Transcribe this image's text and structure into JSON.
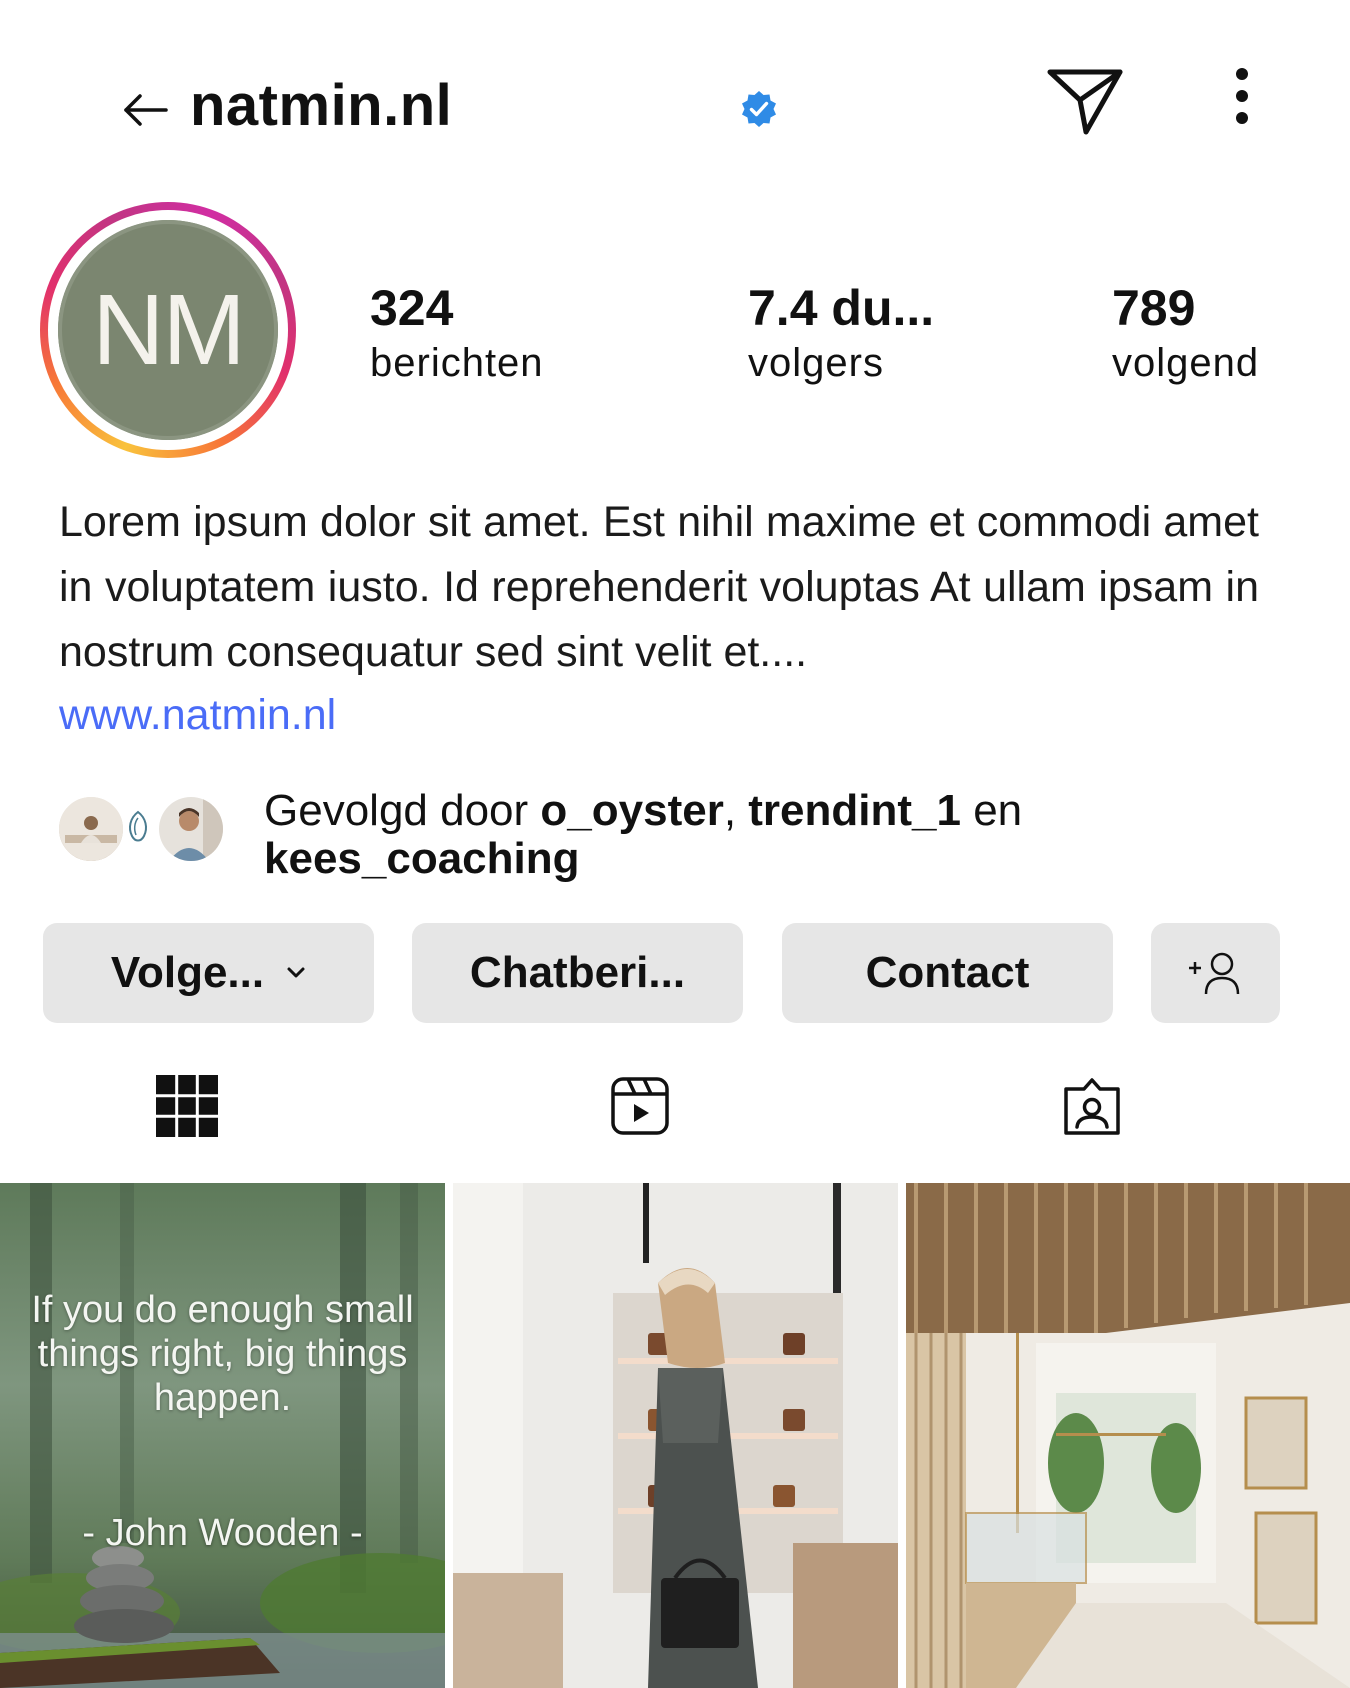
{
  "header": {
    "username": "natmin.nl",
    "icons": {
      "back": "back-arrow-icon",
      "verified": "verified-badge-icon",
      "send": "paper-plane-icon",
      "more": "more-vertical-icon"
    }
  },
  "profile": {
    "avatar_initials": "NM",
    "avatar_color": "#7b8670",
    "stats": [
      {
        "value": "324",
        "label": "berichten"
      },
      {
        "value": "7.4 du...",
        "label": "volgers"
      },
      {
        "value": "789",
        "label": "volgend"
      }
    ]
  },
  "bio": {
    "text": "Lorem ipsum dolor sit amet. Est nihil maxime et commodi amet in voluptatem iusto. Id reprehenderit voluptas At ullam ipsam in nostrum consequatur sed sint velit et....",
    "link": "www.natmin.nl",
    "link_color": "#4a6cf7"
  },
  "followed_by": {
    "prefix": "Gevolgd door ",
    "user1": "o_oyster",
    "sep": ", ",
    "user2": "trendint_1",
    "and": " en",
    "user3": "kees_coaching"
  },
  "buttons": {
    "follow": "Volge...",
    "chat": "Chatberi...",
    "contact": "Contact",
    "add_user_icon": "add-person-icon"
  },
  "tabs": {
    "grid_icon": "grid-icon",
    "reels_icon": "reels-icon",
    "tagged_icon": "tagged-person-icon"
  },
  "posts": [
    {
      "quote": "If you do enough small things right, big things happen.",
      "author": "- John Wooden -"
    },
    {},
    {}
  ]
}
